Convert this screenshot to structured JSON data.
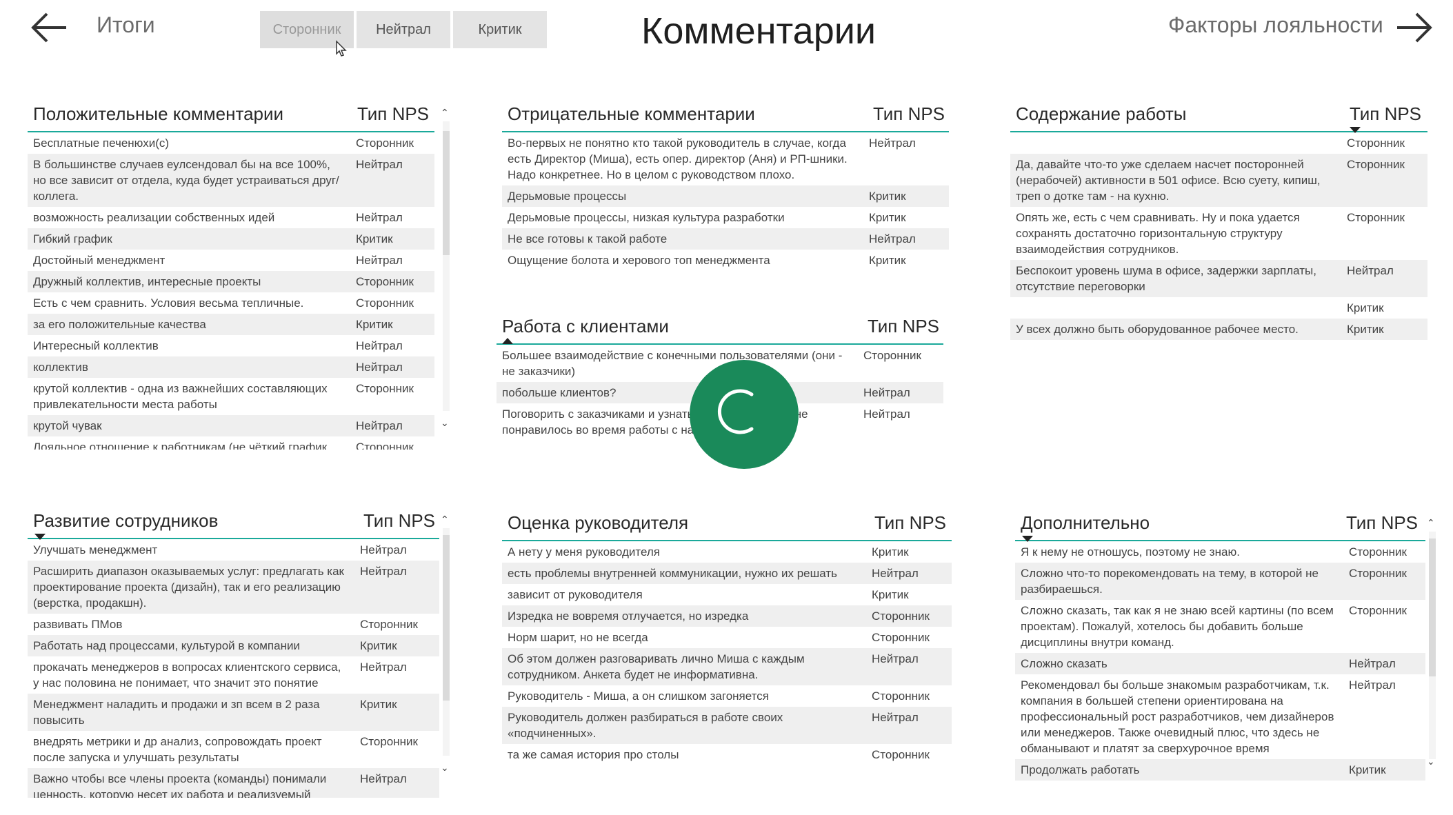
{
  "nav": {
    "back_label": "Итоги",
    "forward_label": "Факторы лояльности",
    "title": "Комментарии"
  },
  "slicer": [
    "Сторонник",
    "Нейтрал",
    "Критик"
  ],
  "colors": {
    "accent": "#1aa99a",
    "spinner": "#1a8a5a"
  },
  "col_type": "Тип NPS",
  "positive": {
    "title": "Положительные комментарии",
    "rows": [
      {
        "text": "Бесплатные печенюхи(с)",
        "type": "Сторонник"
      },
      {
        "text": "В большинстве случаев еулсендовал бы на все 100%, но все зависит от отдела, куда будет устраиваться друг/коллега.",
        "type": "Нейтрал"
      },
      {
        "text": "возможность реализации собственных идей",
        "type": "Нейтрал"
      },
      {
        "text": "Гибкий график",
        "type": "Критик"
      },
      {
        "text": "Достойный менеджмент",
        "type": "Нейтрал"
      },
      {
        "text": "Дружный коллектив, интересные проекты",
        "type": "Сторонник"
      },
      {
        "text": "Есть с чем сравнить. Условия весьма тепличные.",
        "type": "Сторонник"
      },
      {
        "text": "за его положительные качества",
        "type": "Критик"
      },
      {
        "text": "Интересный коллектив",
        "type": "Нейтрал"
      },
      {
        "text": "коллектив",
        "type": "Нейтрал"
      },
      {
        "text": "крутой коллектив - одна из важнейших составляющих привлекательности места работы",
        "type": "Сторонник"
      },
      {
        "text": "крутой чувак",
        "type": "Нейтрал"
      },
      {
        "text": "Лояльное отношение к работникам (не чёткий график, короткий пропуск рабочих дней по болезни без",
        "type": "Сторонник"
      }
    ]
  },
  "negative": {
    "title": "Отрицательные комментарии",
    "rows": [
      {
        "text": "Во-первых не понятно кто такой руководитель в случае, когда есть Директор (Миша), есть опер. директор (Аня) и РП-шники. Надо конкретнее. Но в целом с руководством плохо.",
        "type": "Нейтрал"
      },
      {
        "text": "Дерьмовые процессы",
        "type": "Критик"
      },
      {
        "text": "Дерьмовые процессы, низкая культура разработки",
        "type": "Критик"
      },
      {
        "text": "Не все готовы к такой работе",
        "type": "Нейтрал"
      },
      {
        "text": "Ощущение болота и херового топ менеджмента",
        "type": "Критик"
      }
    ]
  },
  "content": {
    "title": "Содержание работы",
    "rows": [
      {
        "text": "",
        "type": "Сторонник"
      },
      {
        "text": "Да, давайте что-то уже сделаем насчет посторонней (нерабочей) активности в 501 офисе. Всю суету, кипиш, треп о дотке там - на кухню.",
        "type": "Сторонник"
      },
      {
        "text": "Опять же, есть с чем сравнивать. Ну и пока удается сохранять достаточно горизонтальную структуру взаимодействия сотрудников.",
        "type": "Сторонник"
      },
      {
        "text": "Беспокоит уровень шума в офисе, задержки зарплаты, отсутствие переговорки",
        "type": "Нейтрал"
      },
      {
        "text": "",
        "type": "Критик"
      },
      {
        "text": "У всех должно быть оборудованное рабочее место.",
        "type": "Критик"
      }
    ]
  },
  "clients": {
    "title": "Работа с клиентами",
    "rows": [
      {
        "text": "Большее взаимодействие с конечными пользователями (они - не заказчики)",
        "type": "Сторонник"
      },
      {
        "text": "побольше клиентов?",
        "type": "Нейтрал"
      },
      {
        "text": "Поговорить с заказчиками и узнать, что понравилось/не понравилось во время работы с нами",
        "type": "Нейтрал"
      }
    ]
  },
  "development": {
    "title": "Развитие сотрудников",
    "rows": [
      {
        "text": "Улучшать менеджмент",
        "type": "Нейтрал"
      },
      {
        "text": "Расширить диапазон оказываемых услуг: предлагать как проектирование проекта (дизайн), так и его реализацию (верстка, продакшн).",
        "type": "Нейтрал"
      },
      {
        "text": "развивать ПМов",
        "type": "Сторонник"
      },
      {
        "text": "Работать над процессами, культурой в компании",
        "type": "Критик"
      },
      {
        "text": "прокачать менеджеров в вопросах клиентского сервиса, у нас половина не понимает, что значит это понятие",
        "type": "Нейтрал"
      },
      {
        "text": "Менеджмент наладить и продажи и зп всем в 2 раза повысить",
        "type": "Критик"
      },
      {
        "text": "внедрять метрики и др анализ, сопровождать проект после запуска и улучшать результаты",
        "type": "Сторонник"
      },
      {
        "text": "Важно чтобы все члены проекта (команды) понимали ценность, которую несет их работа и реализуемый",
        "type": "Нейтрал"
      }
    ]
  },
  "manager": {
    "title": "Оценка руководителя",
    "rows": [
      {
        "text": "А нету у меня руководителя",
        "type": "Критик"
      },
      {
        "text": "есть проблемы внутренней коммуникации, нужно их решать",
        "type": "Нейтрал"
      },
      {
        "text": "зависит от руководителя",
        "type": "Критик"
      },
      {
        "text": "Изредка не вовремя отлучается, но изредка",
        "type": "Сторонник"
      },
      {
        "text": "Норм шарит, но не всегда",
        "type": "Сторонник"
      },
      {
        "text": "Об этом должен разговаривать лично Миша с каждым сотрудником. Анкета будет не информативна.",
        "type": "Нейтрал"
      },
      {
        "text": "Руководитель - Миша, а он слишком загоняется",
        "type": "Сторонник"
      },
      {
        "text": "Руководитель должен разбираться в работе своих «подчиненных».",
        "type": "Нейтрал"
      },
      {
        "text": "та же самая история про столы",
        "type": "Сторонник"
      }
    ]
  },
  "extra": {
    "title": "Дополнительно",
    "rows": [
      {
        "text": "Я к нему не отношусь, поэтому не знаю.",
        "type": "Сторонник"
      },
      {
        "text": "Сложно что-то порекомендовать на тему, в которой не разбираешься.",
        "type": "Сторонник"
      },
      {
        "text": "Сложно сказать, так как я не знаю всей картины (по всем проектам). Пожалуй, хотелось бы добавить больше дисциплины внутри команд.",
        "type": "Сторонник"
      },
      {
        "text": "Сложно сказать",
        "type": "Нейтрал"
      },
      {
        "text": "Рекомендовал бы больше знакомым разработчикам, т.к. компания в большей степени ориентирована на профессиональный рост разработчиков, чем дизайнеров или менеджеров. Также очевидный плюс, что здесь не обманывают и платят за сверхурочное время",
        "type": "Нейтрал"
      },
      {
        "text": "Продолжать работать",
        "type": "Критик"
      }
    ]
  }
}
